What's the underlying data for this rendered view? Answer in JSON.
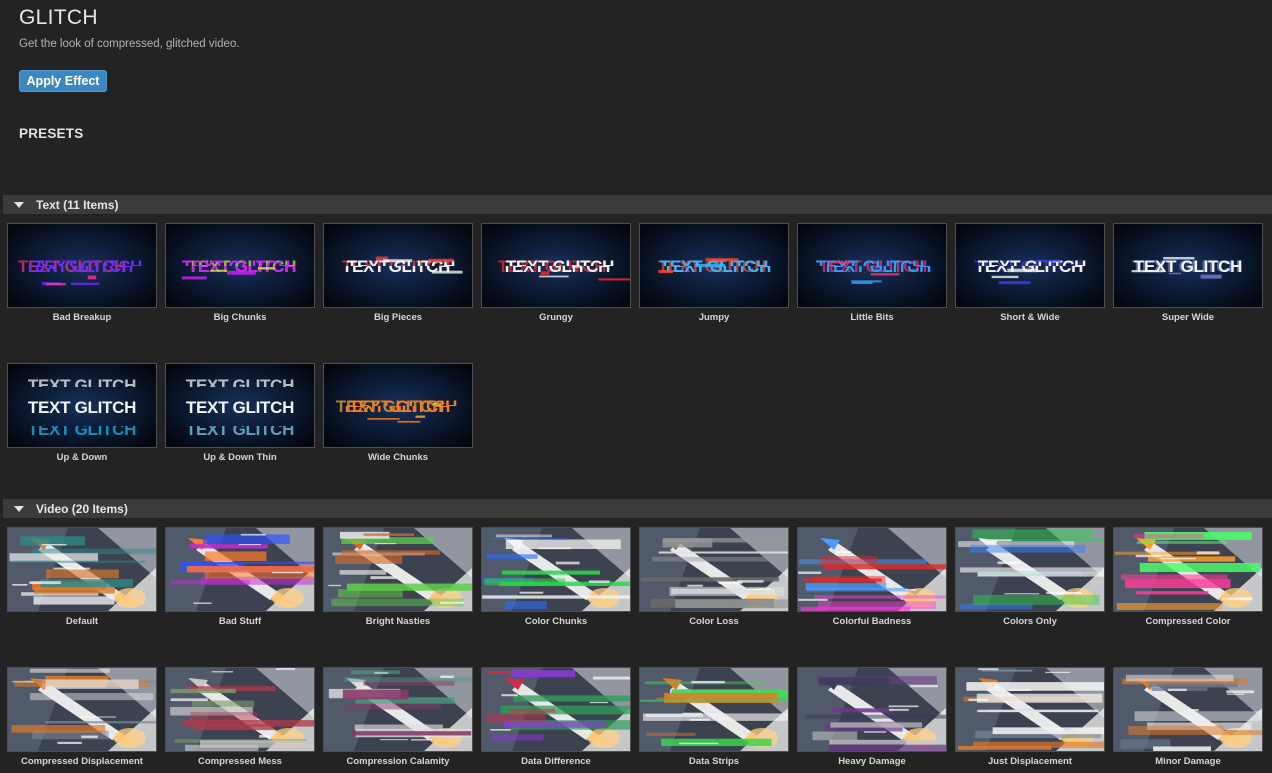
{
  "header": {
    "title": "GLITCH",
    "subtitle": "Get the look of compressed, glitched video.",
    "apply_label": "Apply Effect",
    "presets_label": "PRESETS"
  },
  "sections": {
    "text": {
      "title": "Text (11 Items)",
      "thumb_text": "TEXT GLITCH",
      "items": [
        {
          "label": "Bad Breakup"
        },
        {
          "label": "Big Chunks"
        },
        {
          "label": "Big Pieces"
        },
        {
          "label": "Grungy"
        },
        {
          "label": "Jumpy"
        },
        {
          "label": "Little Bits"
        },
        {
          "label": "Short & Wide"
        },
        {
          "label": "Super Wide"
        },
        {
          "label": "Up & Down"
        },
        {
          "label": "Up & Down Thin"
        },
        {
          "label": "Wide Chunks"
        }
      ]
    },
    "video": {
      "title": "Video (20 Items)",
      "items": [
        {
          "label": "Default"
        },
        {
          "label": "Bad Stuff"
        },
        {
          "label": "Bright Nasties"
        },
        {
          "label": "Color Chunks"
        },
        {
          "label": "Color Loss"
        },
        {
          "label": "Colorful Badness"
        },
        {
          "label": "Colors Only"
        },
        {
          "label": "Compressed Color"
        },
        {
          "label": "Compressed Displacement"
        },
        {
          "label": "Compressed Mess"
        },
        {
          "label": "Compression Calamity"
        },
        {
          "label": "Data Difference"
        },
        {
          "label": "Data Strips"
        },
        {
          "label": "Heavy Damage"
        },
        {
          "label": "Just Displacement"
        },
        {
          "label": "Minor Damage"
        }
      ]
    }
  },
  "colors": {
    "background": "#232323",
    "accent": "#3d87c0",
    "section_bar": "#3b3b3b",
    "thumb_bg": "#050b1a"
  },
  "icons": {
    "section_toggle": "triangle-down-icon"
  }
}
